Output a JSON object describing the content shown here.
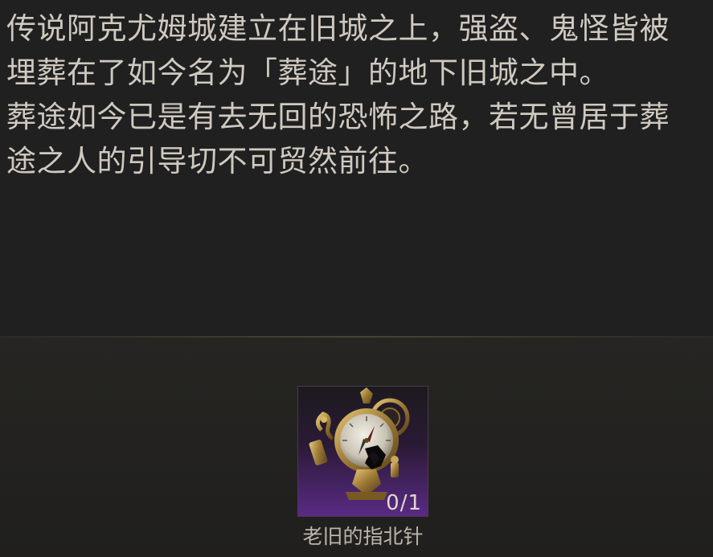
{
  "lore": {
    "lines": [
      "传说阿克尤姆城建立在旧城之上，强盗、鬼怪皆被",
      "埋葬在了如今名为「葬途」的地下旧城之中。",
      "葬途如今已是有去无回的恐怖之路，若无曾居于葬",
      "途之人的引导切不可贸然前往。"
    ]
  },
  "reward": {
    "item_name": "老旧的指北针",
    "item_count": "0/1",
    "item_icon": "old-compass-icon",
    "rarity_color": "#5a2a86"
  }
}
